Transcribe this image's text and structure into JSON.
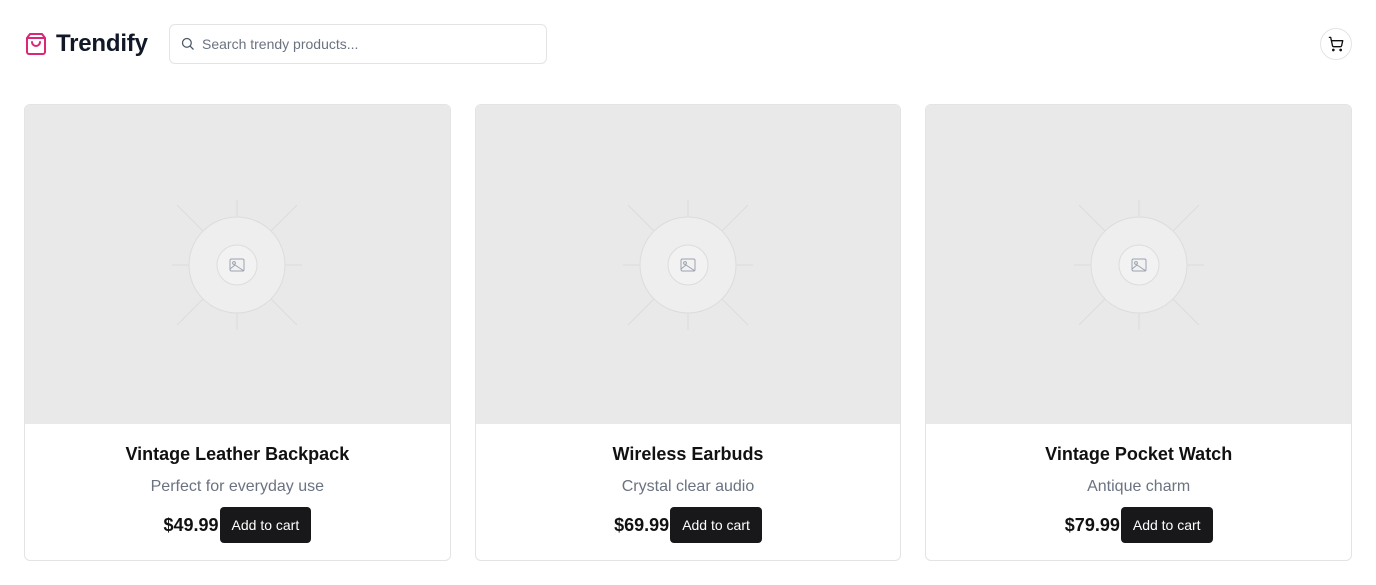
{
  "brand": {
    "name": "Trendify",
    "icon": "shopping-bag-icon",
    "color": "#db2777"
  },
  "search": {
    "placeholder": "Search trendy products...",
    "value": "",
    "icon": "search-icon"
  },
  "cart": {
    "icon": "shopping-cart-icon"
  },
  "products": [
    {
      "title": "Vintage Leather Backpack",
      "description": "Perfect for everyday use",
      "price": "$49.99",
      "button_label": "Add to cart",
      "image": "image-placeholder-icon"
    },
    {
      "title": "Wireless Earbuds",
      "description": "Crystal clear audio",
      "price": "$69.99",
      "button_label": "Add to cart",
      "image": "image-placeholder-icon"
    },
    {
      "title": "Vintage Pocket Watch",
      "description": "Antique charm",
      "price": "$79.99",
      "button_label": "Add to cart",
      "image": "image-placeholder-icon"
    }
  ],
  "colors": {
    "button_bg": "#18181b",
    "image_bg": "#e9e9e9",
    "muted_text": "#6b7280"
  }
}
